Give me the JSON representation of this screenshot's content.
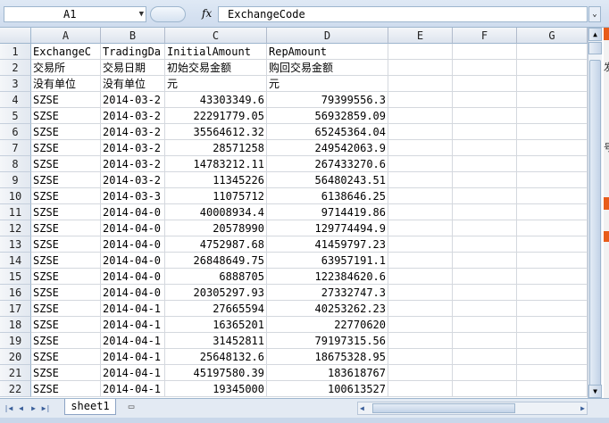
{
  "formula_bar": {
    "name_box": "A1",
    "fx_label": "fx",
    "content": "ExchangeCode"
  },
  "columns": [
    "A",
    "B",
    "C",
    "D",
    "E",
    "F",
    "G"
  ],
  "rows": [
    {
      "n": "1",
      "a": "ExchangeC",
      "b": "TradingDa",
      "c": "InitialAmount",
      "d": "RepAmount"
    },
    {
      "n": "2",
      "a": "交易所",
      "b": "交易日期",
      "c": "初始交易金额",
      "d": "购回交易金额"
    },
    {
      "n": "3",
      "a": "没有单位",
      "b": "没有单位",
      "c": "元",
      "d": "元"
    },
    {
      "n": "4",
      "a": "SZSE",
      "b": "2014-03-2",
      "c": "43303349.6",
      "d": "79399556.3"
    },
    {
      "n": "5",
      "a": "SZSE",
      "b": "2014-03-2",
      "c": "22291779.05",
      "d": "56932859.09"
    },
    {
      "n": "6",
      "a": "SZSE",
      "b": "2014-03-2",
      "c": "35564612.32",
      "d": "65245364.04"
    },
    {
      "n": "7",
      "a": "SZSE",
      "b": "2014-03-2",
      "c": "28571258",
      "d": "249542063.9"
    },
    {
      "n": "8",
      "a": "SZSE",
      "b": "2014-03-2",
      "c": "14783212.11",
      "d": "267433270.6"
    },
    {
      "n": "9",
      "a": "SZSE",
      "b": "2014-03-2",
      "c": "11345226",
      "d": "56480243.51"
    },
    {
      "n": "10",
      "a": "SZSE",
      "b": "2014-03-3",
      "c": "11075712",
      "d": "6138646.25"
    },
    {
      "n": "11",
      "a": "SZSE",
      "b": "2014-04-0",
      "c": "40008934.4",
      "d": "9714419.86"
    },
    {
      "n": "12",
      "a": "SZSE",
      "b": "2014-04-0",
      "c": "20578990",
      "d": "129774494.9"
    },
    {
      "n": "13",
      "a": "SZSE",
      "b": "2014-04-0",
      "c": "4752987.68",
      "d": "41459797.23"
    },
    {
      "n": "14",
      "a": "SZSE",
      "b": "2014-04-0",
      "c": "26848649.75",
      "d": "63957191.1"
    },
    {
      "n": "15",
      "a": "SZSE",
      "b": "2014-04-0",
      "c": "6888705",
      "d": "122384620.6"
    },
    {
      "n": "16",
      "a": "SZSE",
      "b": "2014-04-0",
      "c": "20305297.93",
      "d": "27332747.3"
    },
    {
      "n": "17",
      "a": "SZSE",
      "b": "2014-04-1",
      "c": "27665594",
      "d": "40253262.23"
    },
    {
      "n": "18",
      "a": "SZSE",
      "b": "2014-04-1",
      "c": "16365201",
      "d": "22770620"
    },
    {
      "n": "19",
      "a": "SZSE",
      "b": "2014-04-1",
      "c": "31452811",
      "d": "79197315.56"
    },
    {
      "n": "20",
      "a": "SZSE",
      "b": "2014-04-1",
      "c": "25648132.6",
      "d": "18675328.95"
    },
    {
      "n": "21",
      "a": "SZSE",
      "b": "2014-04-1",
      "c": "45197580.39",
      "d": "183618767"
    },
    {
      "n": "22",
      "a": "SZSE",
      "b": "2014-04-1",
      "c": "19345000",
      "d": "100613527"
    }
  ],
  "sheet_tab": {
    "label": "sheet1"
  },
  "side_panel_text": [
    "发",
    "号"
  ],
  "colors": {
    "accent": "#e85c1a",
    "header_bg": "#dde4ee",
    "grid_line": "#d4d8de"
  }
}
